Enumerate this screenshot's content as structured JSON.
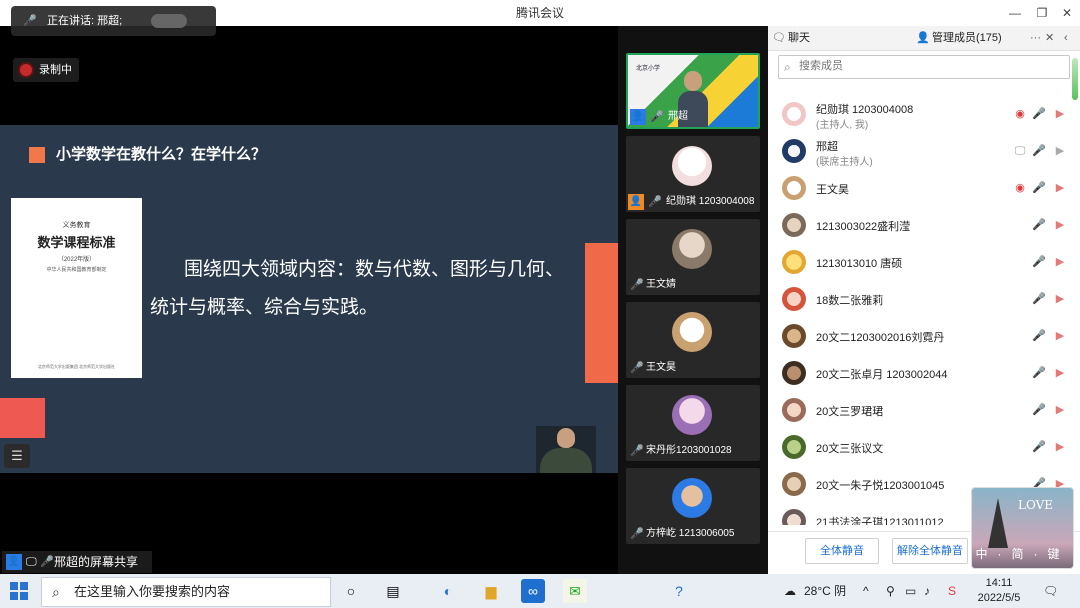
{
  "window": {
    "title": "腾讯会议"
  },
  "controls": {
    "minimize": "—",
    "restore": "❐",
    "close": "✕"
  },
  "speaking": {
    "text": "正在讲话: 邢超;"
  },
  "recording": {
    "label": "录制中"
  },
  "slide": {
    "heading": "小学数学在教什么？在学什么？",
    "body": "围绕四大领域内容：数与代数、图形与几何、统计与概率、综合与实践。",
    "book": {
      "top": "义务教育",
      "title": "数学课程标准",
      "subtitle": "（2022年版）",
      "publisher": "中华人民共和国教育部制定",
      "foot": "北京师范大学出版集团 北京师范大学出版社"
    }
  },
  "share": {
    "label": "邢超的屏幕共享"
  },
  "tiles": [
    {
      "name": "邢超",
      "mic": "on",
      "role": "host",
      "sign": "北京小学"
    },
    {
      "name": "纪勋琪 1203004008",
      "mic": "muted",
      "role": "host"
    },
    {
      "name": "王文婧",
      "mic": "muted"
    },
    {
      "name": "王文昊",
      "mic": "muted"
    },
    {
      "name": "宋丹彤1203001028",
      "mic": "muted"
    },
    {
      "name": "方梓屹 1213006005",
      "mic": "muted"
    }
  ],
  "panel": {
    "chat_tab": "聊天",
    "members_tab": "管理成员(175)",
    "more": "···",
    "close": "✕",
    "search_placeholder": "搜索成员",
    "members": [
      {
        "name": "纪勋琪 1203004008",
        "role": "(主持人, 我)",
        "recording": true
      },
      {
        "name": "邢超",
        "role": "(联席主持人)",
        "mic_on": true
      },
      {
        "name": "王文昊",
        "recording": true
      },
      {
        "name": "1213003022盛利滢"
      },
      {
        "name": "1213013010 唐硕"
      },
      {
        "name": "18数二张雅莉"
      },
      {
        "name": "20文二1203002016刘霓丹"
      },
      {
        "name": "20文二张卓月 1203002044"
      },
      {
        "name": "20文三罗珺珺"
      },
      {
        "name": "20文三张议文"
      },
      {
        "name": "20文一朱子悦1203001045"
      },
      {
        "name": "21书法涂子琪1213011012"
      }
    ],
    "mute_all": "全体静音",
    "unmute_all": "解除全体静音"
  },
  "widget": {
    "love": "LOVE",
    "keys": "中·简·键"
  },
  "taskbar": {
    "search_placeholder": "在这里输入你要搜索的内容",
    "weather": "28°C 阴",
    "time": "14:11",
    "date": "2022/5/5"
  },
  "colors": {
    "slide_bg": "#2a3a4c",
    "accent": "#f0784a",
    "tile_active": "#23a35a",
    "link": "#1f6fd1"
  }
}
